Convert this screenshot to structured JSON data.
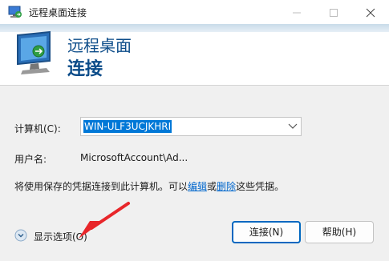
{
  "window": {
    "title": "远程桌面连接"
  },
  "banner": {
    "line1": "远程桌面",
    "line2": "连接"
  },
  "form": {
    "computer_label": "计算机(C):",
    "computer_value": "WIN-ULF3UCJKHRI",
    "user_label": "用户名:",
    "user_value": "MicrosoftAccount\\Ad..."
  },
  "info": {
    "prefix": "将使用保存的凭据连接到此计算机。可以",
    "edit_link": "编辑",
    "or": "或",
    "delete_link": "删除",
    "suffix": "这些凭据。"
  },
  "options": {
    "label": "显示选项(O)"
  },
  "buttons": {
    "connect": "连接(N)",
    "help": "帮助(H)"
  },
  "colors": {
    "accent": "#0067c0",
    "banner_text": "#0c4c89",
    "link": "#0066cc",
    "annotation": "#e8262a"
  },
  "icons": {
    "title": "remote-desktop-icon",
    "banner": "remote-desktop-monitor-icon",
    "options": "chevron-down-circle-icon",
    "combo": "chevron-down-icon"
  }
}
